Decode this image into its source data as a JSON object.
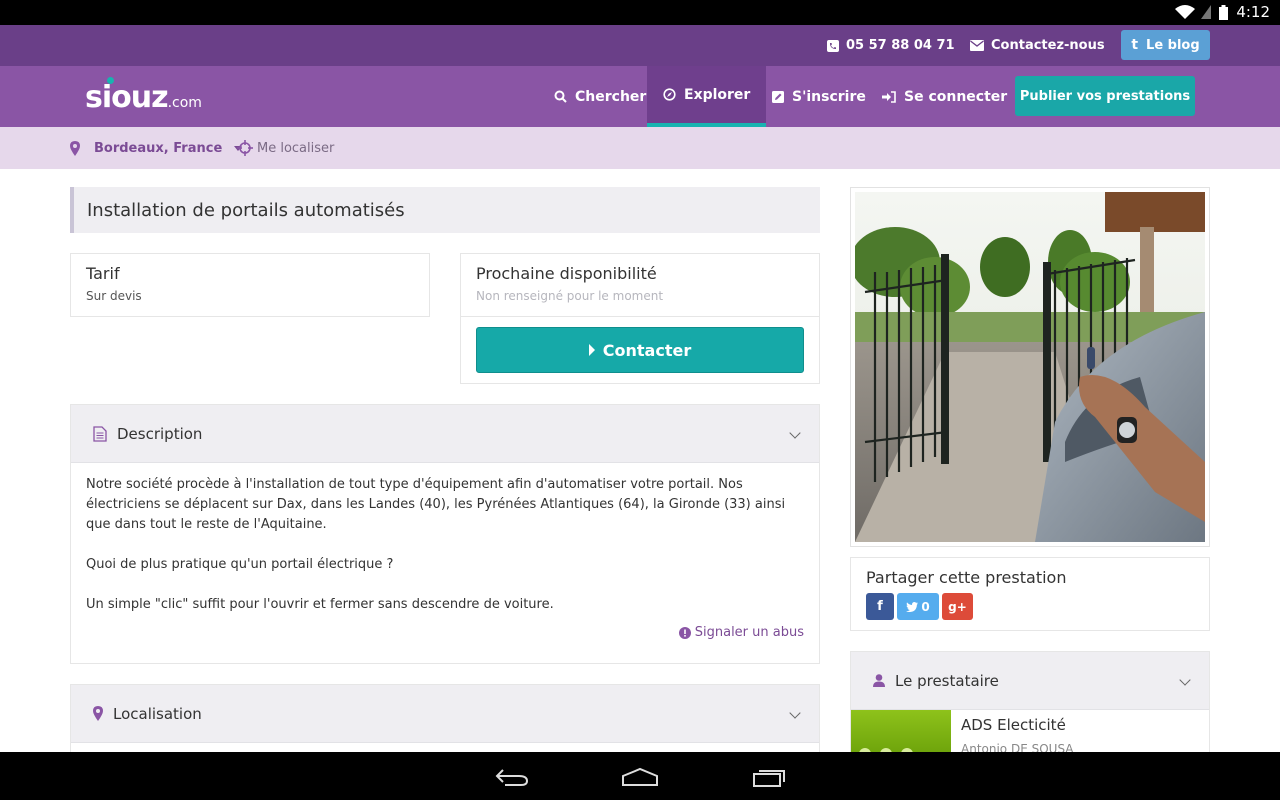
{
  "statusbar": {
    "time": "4:12"
  },
  "topbar": {
    "phone": "05 57 88 04 71",
    "contact": "Contactez-nous",
    "blog": "Le blog"
  },
  "nav": {
    "logo_main": "siouz",
    "logo_suffix": ".com",
    "items": [
      {
        "label": "Chercher",
        "icon": "search-icon"
      },
      {
        "label": "Explorer",
        "icon": "compass-icon",
        "active": true
      },
      {
        "label": "S'inscrire",
        "icon": "edit-icon"
      },
      {
        "label": "Se connecter",
        "icon": "sign-in-icon"
      }
    ],
    "publish": "Publier vos prestations"
  },
  "location": {
    "city": "Bordeaux, France",
    "locate": "Me localiser"
  },
  "listing": {
    "title": "Installation de portails automatisés",
    "tarif_label": "Tarif",
    "tarif_value": "Sur devis",
    "dispo_label": "Prochaine disponibilité",
    "dispo_value": "Non renseigné pour le moment",
    "contact_button": "Contacter"
  },
  "description": {
    "header": "Description",
    "paragraphs": [
      "Notre société procède à l'installation de tout type d'équipement afin d'automatiser votre portail. Nos électriciens se déplacent sur Dax, dans les Landes (40), les Pyrénées Atlantiques (64), la Gironde (33) ainsi que dans tout le reste de l'Aquitaine.",
      "Quoi de plus pratique qu'un portail électrique ?",
      "Un simple \"clic\" suffit pour l'ouvrir et fermer sans descendre de voiture."
    ],
    "report": "Signaler un abus"
  },
  "localisation": {
    "header": "Localisation"
  },
  "share": {
    "title": "Partager cette prestation",
    "twitter_count": "0"
  },
  "provider": {
    "header": "Le prestataire",
    "name": "ADS Electicité",
    "person": "Antonio DE SOUSA"
  },
  "colors": {
    "topbar": "#6a3f88",
    "nav": "#8a55a5",
    "accent": "#1aa7a8",
    "locbar": "#e6d8eb",
    "facebook": "#3b5998",
    "twitter": "#55acee",
    "google": "#dd4b39"
  }
}
